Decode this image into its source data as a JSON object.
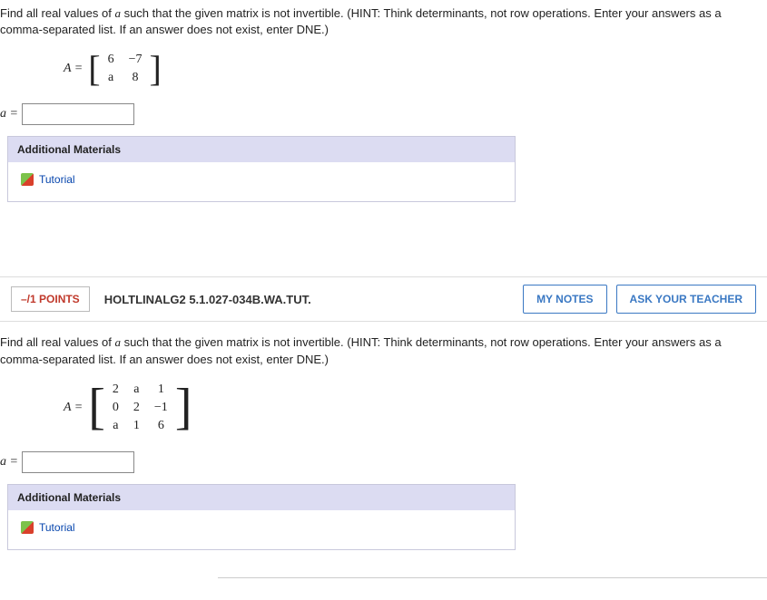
{
  "q1": {
    "prompt_pre": "Find all real values of ",
    "var": "a",
    "prompt_post": " such that the given matrix is not invertible. (HINT: Think determinants, not row operations. Enter your answers as a comma-separated list. If an answer does not exist, enter DNE.)",
    "matrix_label": "A =",
    "matrix": [
      [
        "6",
        "−7"
      ],
      [
        "a",
        "8"
      ]
    ],
    "answer_var": "a =",
    "materials_header": "Additional Materials",
    "tutorial_label": "Tutorial"
  },
  "header2": {
    "points": "–/1 POINTS",
    "topic": "HOLTLINALG2 5.1.027-034B.WA.TUT.",
    "my_notes": "MY NOTES",
    "ask_teacher": "ASK YOUR TEACHER"
  },
  "q2": {
    "prompt_pre": "Find all real values of ",
    "var": "a",
    "prompt_post": " such that the given matrix is not invertible. (HINT: Think determinants, not row operations. Enter your answers as a comma-separated list. If an answer does not exist, enter DNE.)",
    "matrix_label": "A =",
    "matrix": [
      [
        "2",
        "a",
        "1"
      ],
      [
        "0",
        "2",
        "−1"
      ],
      [
        "a",
        "1",
        "6"
      ]
    ],
    "answer_var": "a =",
    "materials_header": "Additional Materials",
    "tutorial_label": "Tutorial"
  }
}
